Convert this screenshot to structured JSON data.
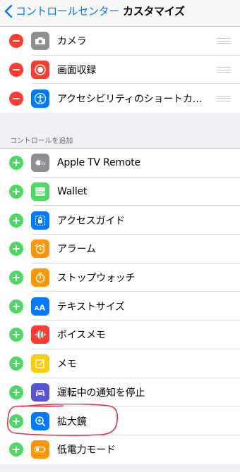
{
  "nav": {
    "back_label": "コントロールセンター",
    "title": "カスタマイズ"
  },
  "included": {
    "items": [
      {
        "label": "カメラ",
        "icon": "camera-icon",
        "color": "#8e8e93"
      },
      {
        "label": "画面収録",
        "icon": "screen-recording-icon",
        "color": "#ff3b30"
      },
      {
        "label": "アクセシビリティのショートカット",
        "icon": "accessibility-icon",
        "color": "#007aff"
      }
    ]
  },
  "more": {
    "header": "コントロールを追加",
    "items": [
      {
        "label": "Apple TV Remote",
        "icon": "apple-tv-icon",
        "color": "#8e8e93"
      },
      {
        "label": "Wallet",
        "icon": "wallet-icon",
        "color": "#4cd964"
      },
      {
        "label": "アクセスガイド",
        "icon": "guided-access-icon",
        "color": "#007aff"
      },
      {
        "label": "アラーム",
        "icon": "alarm-icon",
        "color": "#ff9500"
      },
      {
        "label": "ストップウォッチ",
        "icon": "stopwatch-icon",
        "color": "#ff9500"
      },
      {
        "label": "テキストサイズ",
        "icon": "text-size-icon",
        "color": "#007aff"
      },
      {
        "label": "ボイスメモ",
        "icon": "voice-memo-icon",
        "color": "#ff3b30"
      },
      {
        "label": "メモ",
        "icon": "notes-icon",
        "color": "#ffcc00"
      },
      {
        "label": "運転中の通知を停止",
        "icon": "car-icon",
        "color": "#5856d6"
      },
      {
        "label": "拡大鏡",
        "icon": "magnifier-icon",
        "color": "#007aff"
      },
      {
        "label": "低電力モード",
        "icon": "battery-icon",
        "color": "#ff9500"
      }
    ]
  },
  "annotation": {
    "color": "#e8304a"
  }
}
